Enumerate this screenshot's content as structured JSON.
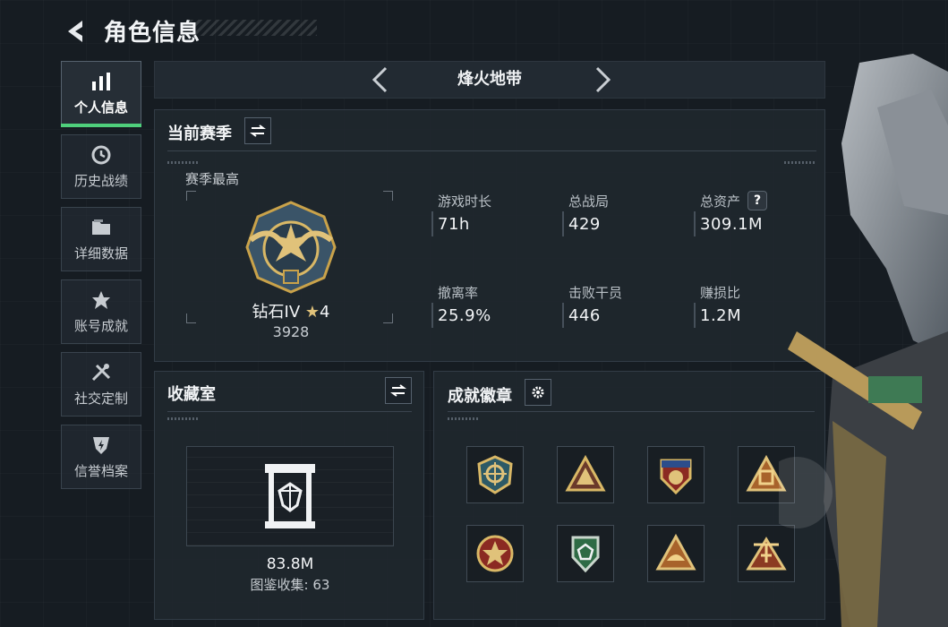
{
  "header": {
    "title": "角色信息"
  },
  "sidebar": {
    "items": [
      {
        "label": "个人信息",
        "icon": "bar-chart-icon",
        "active": true
      },
      {
        "label": "历史战绩",
        "icon": "history-clock-icon"
      },
      {
        "label": "详细数据",
        "icon": "folder-icon"
      },
      {
        "label": "账号成就",
        "icon": "achievement-icon"
      },
      {
        "label": "社交定制",
        "icon": "tools-icon"
      },
      {
        "label": "信誉档案",
        "icon": "shield-bolt-icon"
      }
    ]
  },
  "mode": {
    "name": "烽火地带"
  },
  "season": {
    "title": "当前赛季",
    "best_label": "赛季最高",
    "rank_name": "钻石IV",
    "rank_stars": "4",
    "rank_points": "3928",
    "stats": [
      {
        "label": "游戏时长",
        "value": "71h"
      },
      {
        "label": "总战局",
        "value": "429"
      },
      {
        "label": "总资产",
        "value": "309.1M"
      },
      {
        "label": "撤离率",
        "value": "25.9%"
      },
      {
        "label": "击败干员",
        "value": "446"
      },
      {
        "label": "赚损比",
        "value": "1.2M"
      }
    ],
    "help_glyph": "?"
  },
  "collection": {
    "title": "收藏室",
    "value": "83.8M",
    "catalog_text": "图鉴收集: 63"
  },
  "badges": {
    "title": "成就徽章",
    "items": [
      "crosshair-shield-badge",
      "gold-triangle-badge",
      "star-shield-badge",
      "orange-triangle-badge",
      "red-star-cross-badge",
      "green-shield-badge",
      "pyramid-badge",
      "airplane-badge"
    ]
  },
  "colors": {
    "accent_green": "#4fd07c",
    "gold": "#c9a24a",
    "panel_bg": "#20272e"
  }
}
